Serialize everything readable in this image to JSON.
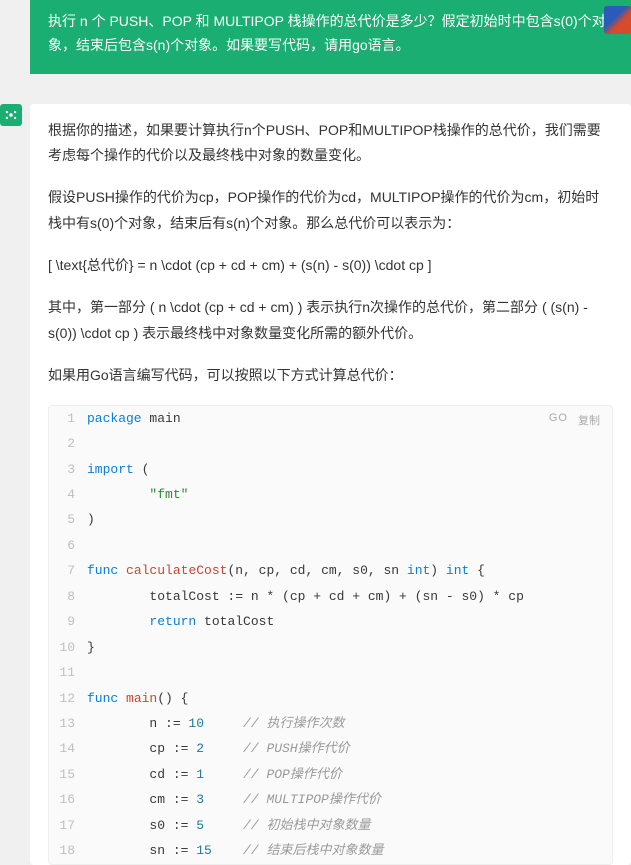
{
  "question": {
    "text": "执行 n 个 PUSH、POP 和 MULTIPOP 栈操作的总代价是多少？假定初始时中包含s(0)个对象，结束后包含s(n)个对象。如果要写代码，请用go语言。"
  },
  "answer": {
    "paragraphs": [
      "根据你的描述，如果要计算执行n个PUSH、POP和MULTIPOP栈操作的总代价，我们需要考虑每个操作的代价以及最终栈中对象的数量变化。",
      "假设PUSH操作的代价为cp，POP操作的代价为cd，MULTIPOP操作的代价为cm，初始时栈中有s(0)个对象，结束后有s(n)个对象。那么总代价可以表示为：",
      "[ \\text{总代价} = n \\cdot (cp + cd + cm) + (s(n) - s(0)) \\cdot cp ]",
      "其中，第一部分 ( n \\cdot (cp + cd + cm) ) 表示执行n次操作的总代价，第二部分 ( (s(n) - s(0)) \\cdot cp ) 表示最终栈中对象数量变化所需的额外代价。",
      "如果用Go语言编写代码，可以按照以下方式计算总代价："
    ]
  },
  "code": {
    "language": "GO",
    "copy_label": "复制",
    "lines": [
      [
        {
          "c": "tok-kw",
          "t": "package"
        },
        {
          "c": "",
          "t": " main"
        }
      ],
      [],
      [
        {
          "c": "tok-kw",
          "t": "import"
        },
        {
          "c": "",
          "t": " ("
        }
      ],
      [
        {
          "c": "",
          "t": "        "
        },
        {
          "c": "tok-str",
          "t": "\"fmt\""
        }
      ],
      [
        {
          "c": "",
          "t": ")"
        }
      ],
      [],
      [
        {
          "c": "tok-kw",
          "t": "func"
        },
        {
          "c": "",
          "t": " "
        },
        {
          "c": "tok-fn",
          "t": "calculateCost"
        },
        {
          "c": "",
          "t": "(n, cp, cd, cm, s0, sn "
        },
        {
          "c": "tok-type",
          "t": "int"
        },
        {
          "c": "",
          "t": ") "
        },
        {
          "c": "tok-type",
          "t": "int"
        },
        {
          "c": "",
          "t": " {"
        }
      ],
      [
        {
          "c": "",
          "t": "        totalCost := n * (cp + cd + cm) + (sn - s0) * cp"
        }
      ],
      [
        {
          "c": "",
          "t": "        "
        },
        {
          "c": "tok-kw",
          "t": "return"
        },
        {
          "c": "",
          "t": " totalCost"
        }
      ],
      [
        {
          "c": "",
          "t": "}"
        }
      ],
      [],
      [
        {
          "c": "tok-kw",
          "t": "func"
        },
        {
          "c": "",
          "t": " "
        },
        {
          "c": "tok-fn",
          "t": "main"
        },
        {
          "c": "",
          "t": "() {"
        }
      ],
      [
        {
          "c": "",
          "t": "        n := "
        },
        {
          "c": "tok-num",
          "t": "10"
        },
        {
          "c": "",
          "t": "     "
        },
        {
          "c": "tok-cmt",
          "t": "// 执行操作次数"
        }
      ],
      [
        {
          "c": "",
          "t": "        cp := "
        },
        {
          "c": "tok-num",
          "t": "2"
        },
        {
          "c": "",
          "t": "     "
        },
        {
          "c": "tok-cmt",
          "t": "// PUSH操作代价"
        }
      ],
      [
        {
          "c": "",
          "t": "        cd := "
        },
        {
          "c": "tok-num",
          "t": "1"
        },
        {
          "c": "",
          "t": "     "
        },
        {
          "c": "tok-cmt",
          "t": "// POP操作代价"
        }
      ],
      [
        {
          "c": "",
          "t": "        cm := "
        },
        {
          "c": "tok-num",
          "t": "3"
        },
        {
          "c": "",
          "t": "     "
        },
        {
          "c": "tok-cmt",
          "t": "// MULTIPOP操作代价"
        }
      ],
      [
        {
          "c": "",
          "t": "        s0 := "
        },
        {
          "c": "tok-num",
          "t": "5"
        },
        {
          "c": "",
          "t": "     "
        },
        {
          "c": "tok-cmt",
          "t": "// 初始栈中对象数量"
        }
      ],
      [
        {
          "c": "",
          "t": "        sn := "
        },
        {
          "c": "tok-num",
          "t": "15"
        },
        {
          "c": "",
          "t": "    "
        },
        {
          "c": "tok-cmt",
          "t": "// 结束后栈中对象数量"
        }
      ]
    ]
  }
}
